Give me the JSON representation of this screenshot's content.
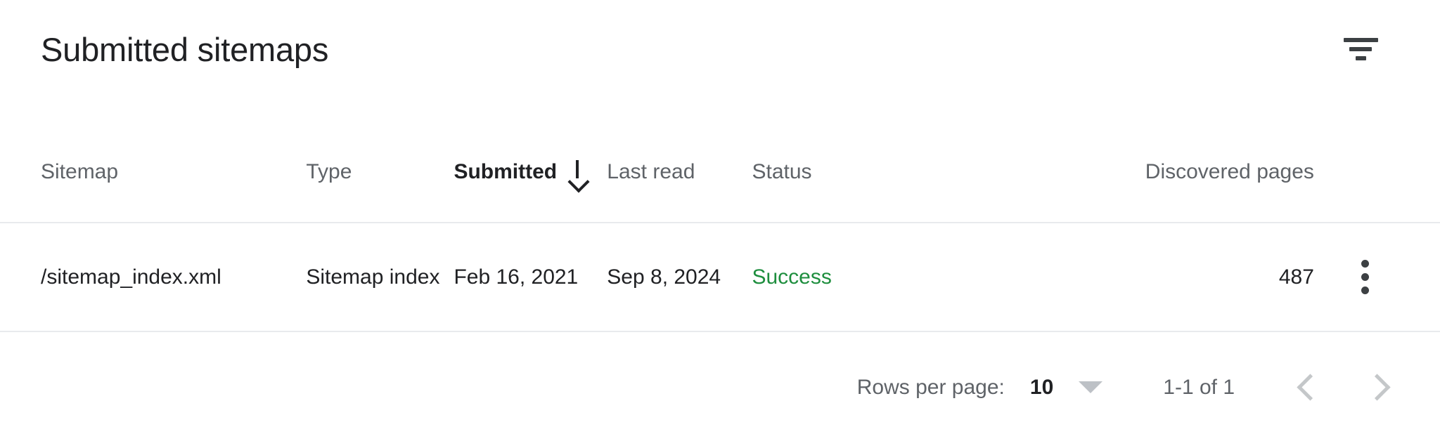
{
  "panel": {
    "title": "Submitted sitemaps",
    "filter_icon": "filter-icon"
  },
  "table": {
    "columns": [
      {
        "key": "sitemap",
        "label": "Sitemap",
        "sorted": false
      },
      {
        "key": "type",
        "label": "Type",
        "sorted": false
      },
      {
        "key": "submitted",
        "label": "Submitted",
        "sorted": true,
        "sort_direction": "descending",
        "sort_icon": "arrow-down-icon"
      },
      {
        "key": "lastread",
        "label": "Last read",
        "sorted": false
      },
      {
        "key": "status",
        "label": "Status",
        "sorted": false
      },
      {
        "key": "pages",
        "label": "Discovered pages",
        "sorted": false
      }
    ],
    "rows": [
      {
        "sitemap": "/sitemap_index.xml",
        "type": "Sitemap index",
        "submitted": "Feb 16, 2021",
        "lastread": "Sep 8, 2024",
        "status": "Success",
        "status_color": "#1e8e3e",
        "pages": "487",
        "menu_icon": "more-vert-icon"
      }
    ]
  },
  "pagination": {
    "rows_per_page_label": "Rows per page:",
    "rows_per_page_value": "10",
    "rows_per_page_caret": "chevron-down-icon",
    "range_label": "1-1 of 1",
    "prev_icon": "chevron-left-icon",
    "next_icon": "chevron-right-icon"
  },
  "colors": {
    "text_primary": "#202124",
    "text_secondary": "#5f6368",
    "divider": "#e8eaed",
    "success": "#1e8e3e",
    "background": "#ffffff"
  }
}
